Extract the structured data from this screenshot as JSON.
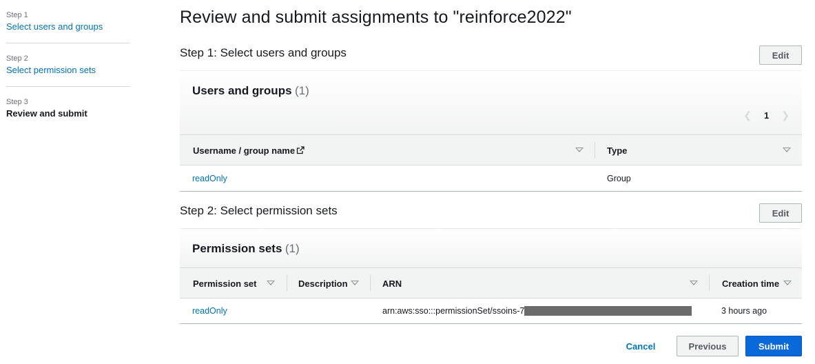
{
  "sidebar": {
    "steps": [
      {
        "number": "Step 1",
        "label": "Select users and groups"
      },
      {
        "number": "Step 2",
        "label": "Select permission sets"
      },
      {
        "number": "Step 3",
        "label": "Review and submit"
      }
    ]
  },
  "page": {
    "title": "Review and submit assignments to \"reinforce2022\""
  },
  "step1": {
    "heading": "Step 1: Select users and groups",
    "edit_label": "Edit",
    "panel_title": "Users and groups",
    "panel_count": "(1)",
    "page_number": "1",
    "columns": [
      "Username / group name",
      "Type"
    ],
    "rows": [
      {
        "name": "readOnly",
        "type": "Group"
      }
    ]
  },
  "step2": {
    "heading": "Step 2: Select permission sets",
    "edit_label": "Edit",
    "panel_title": "Permission sets",
    "panel_count": "(1)",
    "columns": [
      "Permission set",
      "Description",
      "ARN",
      "Creation time"
    ],
    "rows": [
      {
        "permission_set": "readOnly",
        "description": "",
        "arn": "arn:aws:sso:::permissionSet/ssoins-7",
        "creation_time": "3 hours ago"
      }
    ]
  },
  "footer": {
    "cancel_label": "Cancel",
    "previous_label": "Previous",
    "submit_label": "Submit"
  },
  "colors": {
    "link": "#0073bb",
    "primary": "#0a69d8",
    "header_bg": "#f2f3f3"
  }
}
